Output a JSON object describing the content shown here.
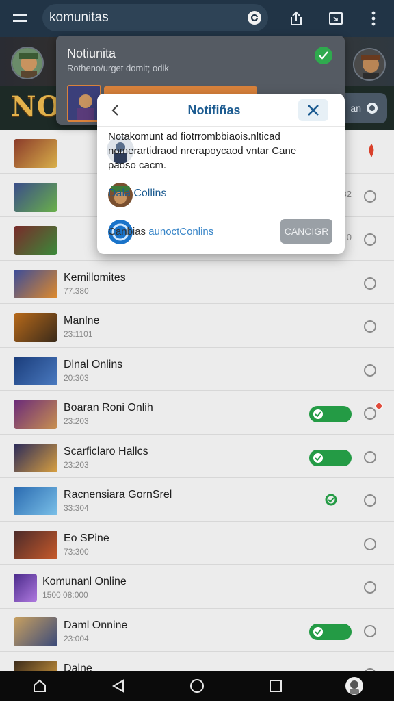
{
  "appbar": {
    "search_text": "komunitas"
  },
  "banner": {
    "logo_text": "NO",
    "pill_text": "an"
  },
  "notification": {
    "title": "Notiunita",
    "subtitle": "Rotheno/urget domit; odik"
  },
  "dialog": {
    "title": "Notifiñas",
    "message_lead": "Notakomunt",
    "message_rest": " ad fiotrrombbiaois.nlticad nomerartidraod nrerapoycaod vntar Cane paoso cacm.",
    "name": "Dala Collins",
    "contact_prefix": "Canbias ",
    "contact_highlight": "aunoctConlins",
    "cancel_label": "CANCIGR"
  },
  "list": {
    "rows": [
      {
        "title": "",
        "sub": "",
        "control": "radio"
      },
      {
        "title": "",
        "sub": "",
        "control": "radio"
      },
      {
        "title": "",
        "sub": "",
        "control": "radio"
      },
      {
        "title": "Kemillomites",
        "sub": "77.380",
        "control": "radio"
      },
      {
        "title": "Manlne",
        "sub": "23:1101",
        "control": "radio"
      },
      {
        "title": "Dlnal Onlins",
        "sub": "20:303",
        "control": "radio"
      },
      {
        "title": "Boaran Roni Onlih",
        "sub": "23:203",
        "control": "toggle"
      },
      {
        "title": "Scarficlaro Hallcs",
        "sub": "23:203",
        "control": "toggle"
      },
      {
        "title": "Racnensiara GornSrel",
        "sub": "33:304",
        "control": "toggle-small"
      },
      {
        "title": "Eo SPine",
        "sub": "73:300",
        "control": "radio"
      },
      {
        "title": "Komunanl Online",
        "sub": "1500 08:000",
        "control": "radio"
      },
      {
        "title": "Daml Onnine",
        "sub": "23:004",
        "control": "toggle"
      },
      {
        "title": "Dalne",
        "sub": "",
        "control": "radio"
      }
    ],
    "partial_labels": [
      "32",
      "0"
    ]
  },
  "colors": {
    "appbar": "#213446",
    "accent_blue": "#1d5c91",
    "toggle_green": "#249b45",
    "navbar": "#0b0b0b"
  },
  "icons": [
    "menu-icon",
    "share-icon",
    "cast-icon",
    "more-vert-icon",
    "back-icon",
    "close-icon",
    "home-icon",
    "nav-back-icon",
    "nav-home-icon",
    "nav-recents-icon"
  ]
}
